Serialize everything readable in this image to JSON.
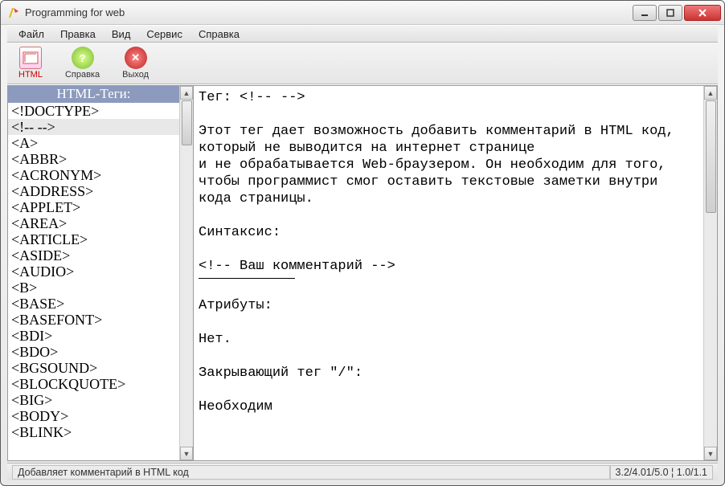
{
  "window": {
    "title": "Programming for web"
  },
  "menubar": [
    "Файл",
    "Правка",
    "Вид",
    "Сервис",
    "Справка"
  ],
  "toolbar": {
    "html": "HTML",
    "help": "Справка",
    "exit": "Выход"
  },
  "sidebar": {
    "header": "HTML-Теги:",
    "selected_index": 1,
    "items": [
      "<!DOCTYPE>",
      "<!-- -->",
      "<A>",
      "<ABBR>",
      "<ACRONYM>",
      "<ADDRESS>",
      "<APPLET>",
      "<AREA>",
      "<ARTICLE>",
      "<ASIDE>",
      "<AUDIO>",
      "<B>",
      "<BASE>",
      "<BASEFONT>",
      "<BDI>",
      "<BDO>",
      "<BGSOUND>",
      "<BLOCKQUOTE>",
      "<BIG>",
      "<BODY>",
      "<BLINK>"
    ]
  },
  "detail": {
    "l1": "Тег: <!-- -->",
    "l2": "Этот тег дает возможность добавить комментарий в HTML код, который не выводится на интернет странице",
    "l3": "и не обрабатывается Web-браузером. Он необходим для того, чтобы программист смог оставить текстовые заметки внутри кода страницы.",
    "l4": "Синтаксис:",
    "l5": "<!-- Ваш комментарий -->",
    "l6": "Атрибуты:",
    "l7": "Нет.",
    "l8": "Закрывающий тег \"/\":",
    "l9": "Необходим"
  },
  "status": {
    "left": "Добавляет комментарий в HTML код",
    "right": "3.2/4.01/5.0 ¦ 1.0/1.1"
  }
}
